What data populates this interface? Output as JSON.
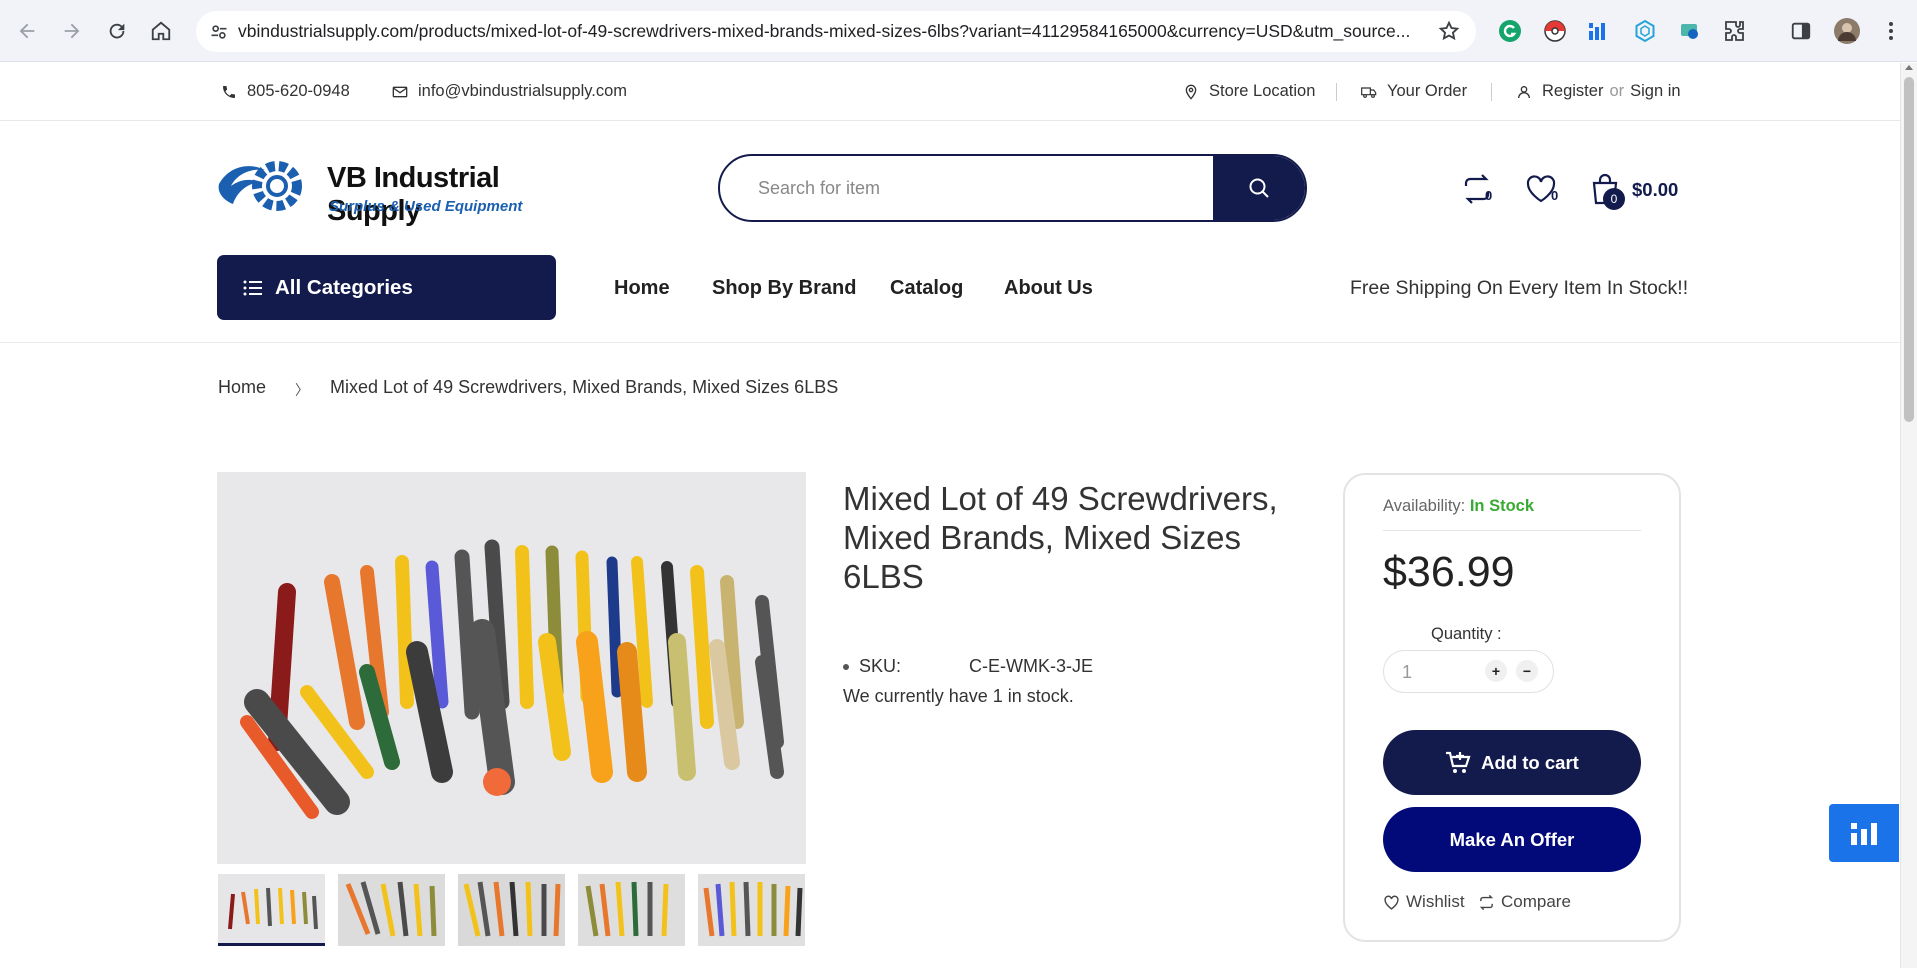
{
  "browser": {
    "url": "vbindustrialsupply.com/products/mixed-lot-of-49-screwdrivers-mixed-brands-mixed-sizes-6lbs?variant=41129584165000&currency=USD&utm_source..."
  },
  "topbar": {
    "phone": "805-620-0948",
    "email": "info@vbindustrialsupply.com",
    "store_location": "Store Location",
    "your_order": "Your Order",
    "register": "Register",
    "or": "or",
    "sign_in": "Sign in"
  },
  "header": {
    "logo_name": "VB Industrial Supply",
    "logo_tagline": "Surplus & Used Equipment",
    "search_placeholder": "Search for item",
    "compare_count": "0",
    "wishlist_count": "0",
    "cart_count": "0",
    "cart_total": "$0.00"
  },
  "nav": {
    "all_categories": "All Categories",
    "items": [
      "Home",
      "Shop By Brand",
      "Catalog",
      "About Us"
    ],
    "promo": "Free Shipping On Every Item In Stock!!"
  },
  "breadcrumb": {
    "home": "Home",
    "separator": "〉",
    "current": "Mixed Lot of 49 Screwdrivers, Mixed Brands, Mixed Sizes 6LBS"
  },
  "product": {
    "title": "Mixed Lot of 49 Screwdrivers, Mixed Brands, Mixed Sizes 6LBS",
    "sku_label": "SKU:",
    "sku_value": "C-E-WMK-3-JE",
    "stock_text": "We currently have 1 in stock.",
    "availability_label": "Availability:",
    "availability_value": "In Stock",
    "price": "$36.99",
    "quantity_label": "Quantity :",
    "quantity_value": "1",
    "add_to_cart": "Add to cart",
    "make_offer": "Make An Offer",
    "wishlist": "Wishlist",
    "compare": "Compare"
  },
  "colors": {
    "brand_navy": "#131b4d",
    "offer_blue": "#020a7a",
    "in_stock_green": "#3aaa35",
    "widget_blue": "#1a73e8"
  }
}
